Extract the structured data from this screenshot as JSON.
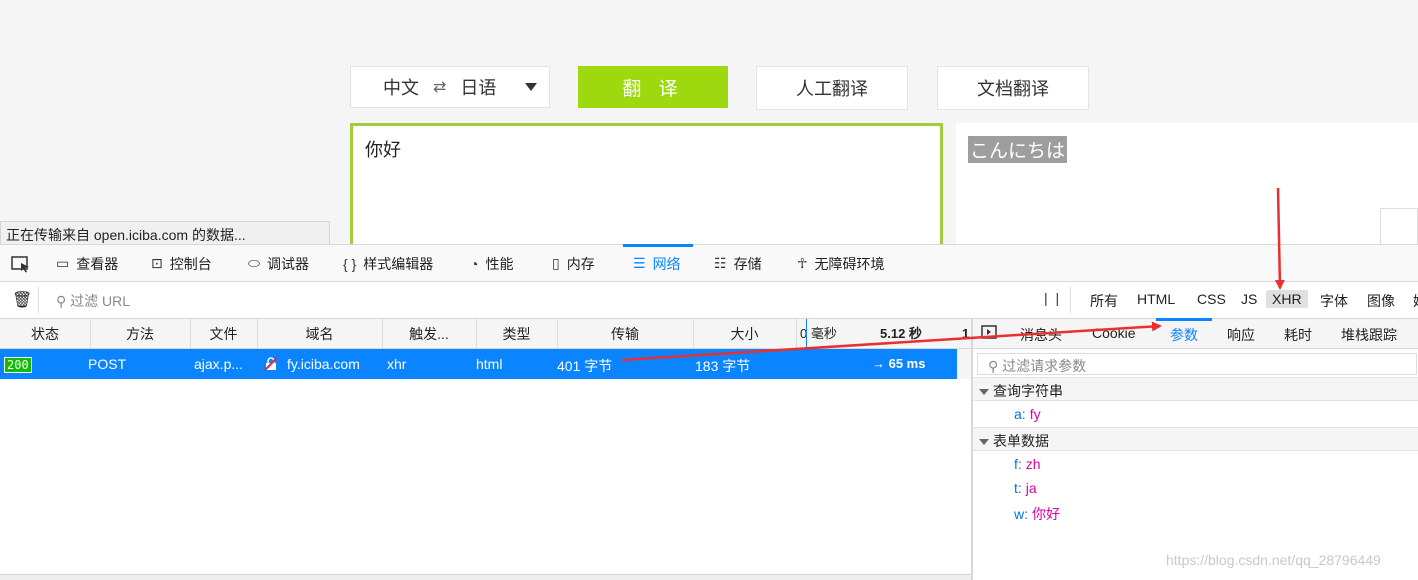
{
  "page": {
    "lang_from": "中文",
    "swap_icon": "⇄",
    "lang_to": "日语",
    "translate_btn": "翻 译",
    "human_translate_btn": "人工翻译",
    "doc_translate_btn": "文档翻译",
    "input_text": "你好",
    "output_text": "こんにちは",
    "status_text": "正在传输来自 open.iciba.com 的数据..."
  },
  "devtools": {
    "tools": [
      {
        "label": "查看器",
        "icon": "inspector-icon"
      },
      {
        "label": "控制台",
        "icon": "console-icon"
      },
      {
        "label": "调试器",
        "icon": "debugger-icon"
      },
      {
        "label": "样式编辑器",
        "icon": "style-editor-icon"
      },
      {
        "label": "性能",
        "icon": "performance-icon"
      },
      {
        "label": "内存",
        "icon": "memory-icon"
      },
      {
        "label": "网络",
        "icon": "network-icon"
      },
      {
        "label": "存储",
        "icon": "storage-icon"
      },
      {
        "label": "无障碍环境",
        "icon": "accessibility-icon"
      }
    ],
    "filter_placeholder": "过滤 URL",
    "pause_glyph": "| |",
    "type_filters": [
      "所有",
      "HTML",
      "CSS",
      "JS",
      "XHR",
      "字体",
      "图像",
      "媒"
    ],
    "selected_type": "XHR",
    "columns": [
      "状态",
      "方法",
      "文件",
      "域名",
      "触发...",
      "类型",
      "传输",
      "大小"
    ],
    "timeline_marks": [
      "0 毫秒",
      "5.12 秒",
      "1"
    ],
    "request": {
      "status": "200",
      "method": "POST",
      "file": "ajax.p...",
      "domain": "fy.iciba.com",
      "cause": "xhr",
      "type": "html",
      "transferred": "401 字节",
      "size": "183 字节",
      "timing": "→ 65 ms"
    },
    "side_tabs": [
      "消息头",
      "Cookie",
      "参数",
      "响应",
      "耗时",
      "堆栈跟踪"
    ],
    "active_side_tab": "参数",
    "param_filter_placeholder": "过滤请求参数",
    "query_section": "查询字符串",
    "query_params": [
      {
        "key": "a:",
        "value": "fy"
      }
    ],
    "form_section": "表单数据",
    "form_params": [
      {
        "key": "f:",
        "value": "zh"
      },
      {
        "key": "t:",
        "value": "ja"
      },
      {
        "key": "w:",
        "value": "你好"
      }
    ]
  },
  "watermark": "https://blog.csdn.net/qq_28796449",
  "colors": {
    "accent": "#0a84ff",
    "translate_green": "#9ed80f",
    "annotation_red": "#e8312e"
  }
}
